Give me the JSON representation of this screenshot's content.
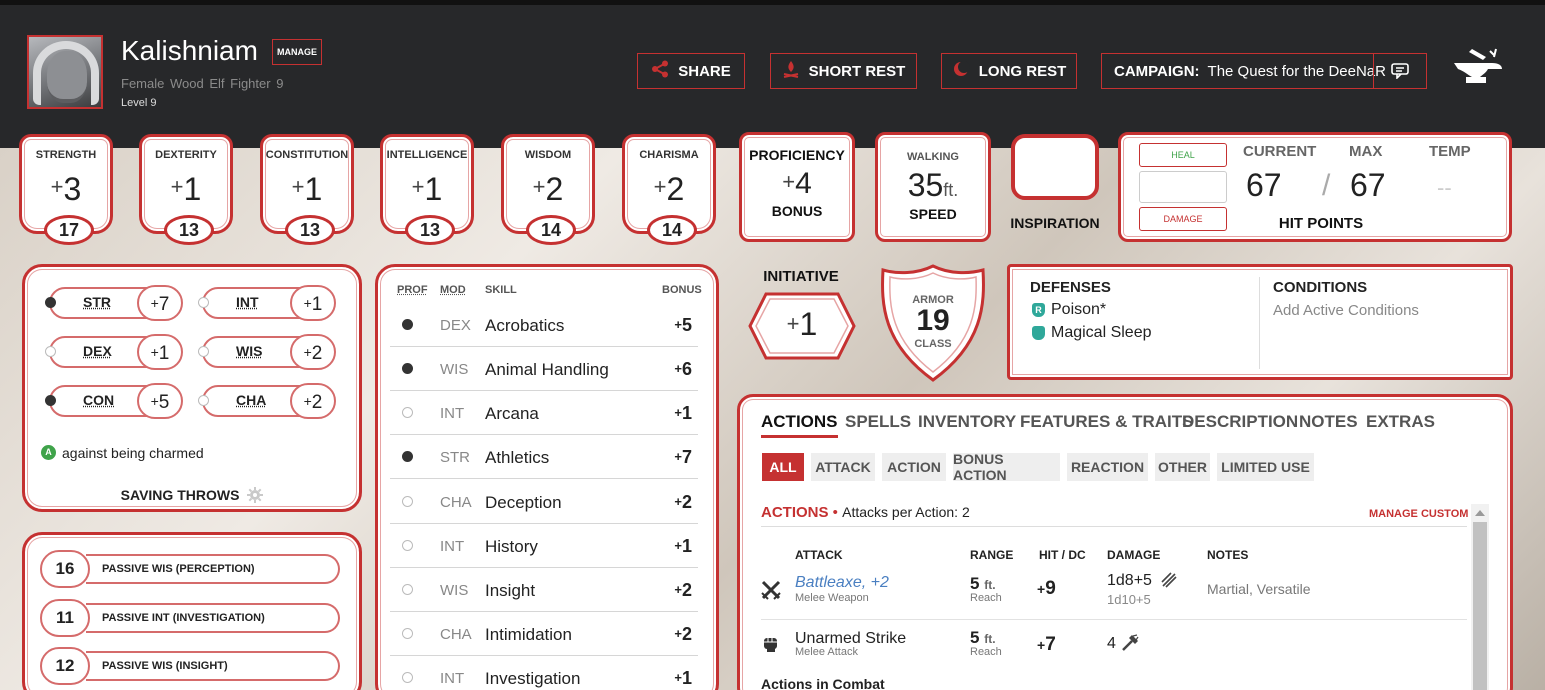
{
  "character": {
    "name": "Kalishniam",
    "manage_label": "MANAGE",
    "gender": "Female",
    "race": "Wood Elf",
    "class": "Fighter 9",
    "level": "Level 9"
  },
  "header_buttons": {
    "share": "SHARE",
    "short_rest": "SHORT REST",
    "long_rest": "LONG REST"
  },
  "campaign": {
    "label": "CAMPAIGN:",
    "name": "The Quest for the DeeNaR"
  },
  "abilities": [
    {
      "label": "STRENGTH",
      "sign": "+",
      "mod": "3",
      "score": "17"
    },
    {
      "label": "DEXTERITY",
      "sign": "+",
      "mod": "1",
      "score": "13"
    },
    {
      "label": "CONSTITUTION",
      "sign": "+",
      "mod": "1",
      "score": "13"
    },
    {
      "label": "INTELLIGENCE",
      "sign": "+",
      "mod": "1",
      "score": "13"
    },
    {
      "label": "WISDOM",
      "sign": "+",
      "mod": "2",
      "score": "14"
    },
    {
      "label": "CHARISMA",
      "sign": "+",
      "mod": "2",
      "score": "14"
    }
  ],
  "proficiency": {
    "top": "PROFICIENCY",
    "sign": "+",
    "value": "4",
    "bottom": "BONUS"
  },
  "speed": {
    "top": "WALKING",
    "value": "35",
    "unit": "ft.",
    "bottom": "SPEED"
  },
  "inspiration": {
    "label": "INSPIRATION"
  },
  "hit_points": {
    "heal": "HEAL",
    "damage": "DAMAGE",
    "current_label": "CURRENT",
    "max_label": "MAX",
    "temp_label": "TEMP",
    "current": "67",
    "max": "67",
    "temp": "--",
    "separator": "/",
    "title": "HIT POINTS"
  },
  "saving_throws": {
    "items": [
      {
        "name": "STR",
        "sign": "+",
        "bonus": "7",
        "proficient": true
      },
      {
        "name": "INT",
        "sign": "+",
        "bonus": "1",
        "proficient": false
      },
      {
        "name": "DEX",
        "sign": "+",
        "bonus": "1",
        "proficient": false
      },
      {
        "name": "WIS",
        "sign": "+",
        "bonus": "2",
        "proficient": false
      },
      {
        "name": "CON",
        "sign": "+",
        "bonus": "5",
        "proficient": true
      },
      {
        "name": "CHA",
        "sign": "+",
        "bonus": "2",
        "proficient": false
      }
    ],
    "advantage_badge": "A",
    "advantage_note": "against being charmed",
    "title": "SAVING THROWS"
  },
  "passives": [
    {
      "value": "16",
      "label": "PASSIVE WIS (PERCEPTION)"
    },
    {
      "value": "11",
      "label": "PASSIVE INT (INVESTIGATION)"
    },
    {
      "value": "12",
      "label": "PASSIVE WIS (INSIGHT)"
    }
  ],
  "skills": {
    "headers": {
      "prof": "PROF",
      "mod": "MOD",
      "skill": "SKILL",
      "bonus": "BONUS"
    },
    "rows": [
      {
        "mod": "DEX",
        "name": "Acrobatics",
        "sign": "+",
        "bonus": "5",
        "proficient": true
      },
      {
        "mod": "WIS",
        "name": "Animal Handling",
        "sign": "+",
        "bonus": "6",
        "proficient": true
      },
      {
        "mod": "INT",
        "name": "Arcana",
        "sign": "+",
        "bonus": "1",
        "proficient": false
      },
      {
        "mod": "STR",
        "name": "Athletics",
        "sign": "+",
        "bonus": "7",
        "proficient": true
      },
      {
        "mod": "CHA",
        "name": "Deception",
        "sign": "+",
        "bonus": "2",
        "proficient": false
      },
      {
        "mod": "INT",
        "name": "History",
        "sign": "+",
        "bonus": "1",
        "proficient": false
      },
      {
        "mod": "WIS",
        "name": "Insight",
        "sign": "+",
        "bonus": "2",
        "proficient": false
      },
      {
        "mod": "CHA",
        "name": "Intimidation",
        "sign": "+",
        "bonus": "2",
        "proficient": false
      },
      {
        "mod": "INT",
        "name": "Investigation",
        "sign": "+",
        "bonus": "1",
        "proficient": false
      }
    ]
  },
  "initiative": {
    "label": "INITIATIVE",
    "sign": "+",
    "value": "1"
  },
  "armor": {
    "top": "ARMOR",
    "value": "19",
    "bottom": "CLASS"
  },
  "defenses": {
    "title": "DEFENSES",
    "items": [
      {
        "badge": "R",
        "text": "Poison*"
      },
      {
        "badge": "",
        "text": "Magical Sleep"
      }
    ]
  },
  "conditions": {
    "title": "CONDITIONS",
    "placeholder": "Add Active Conditions"
  },
  "tabs": [
    "ACTIONS",
    "SPELLS",
    "INVENTORY",
    "FEATURES & TRAITS",
    "DESCRIPTION",
    "NOTES",
    "EXTRAS"
  ],
  "filters": [
    "ALL",
    "ATTACK",
    "ACTION",
    "BONUS ACTION",
    "REACTION",
    "OTHER",
    "LIMITED USE"
  ],
  "actions": {
    "title": "ACTIONS",
    "bullet": "•",
    "attacks_per_action": "Attacks per Action: 2",
    "manage_custom": "MANAGE CUSTOM",
    "columns": {
      "attack": "ATTACK",
      "range": "RANGE",
      "hit": "HIT / DC",
      "damage": "DAMAGE",
      "notes": "NOTES"
    },
    "rows": [
      {
        "name": "Battleaxe, +2",
        "sub": "Melee Weapon",
        "range": "5",
        "unit": "ft.",
        "range_sub": "Reach",
        "sign": "+",
        "hit": "9",
        "damage": "1d8+5",
        "damage_alt": "1d10+5",
        "notes": "Martial, Versatile"
      },
      {
        "name": "Unarmed Strike",
        "sub": "Melee Attack",
        "range": "5",
        "unit": "ft.",
        "range_sub": "Reach",
        "sign": "+",
        "hit": "7",
        "damage": "4",
        "damage_alt": "",
        "notes": ""
      }
    ],
    "in_combat": "Actions in Combat"
  },
  "colors": {
    "accent": "#c53131",
    "header_bg": "#27282a",
    "link": "#4a7fc1"
  }
}
